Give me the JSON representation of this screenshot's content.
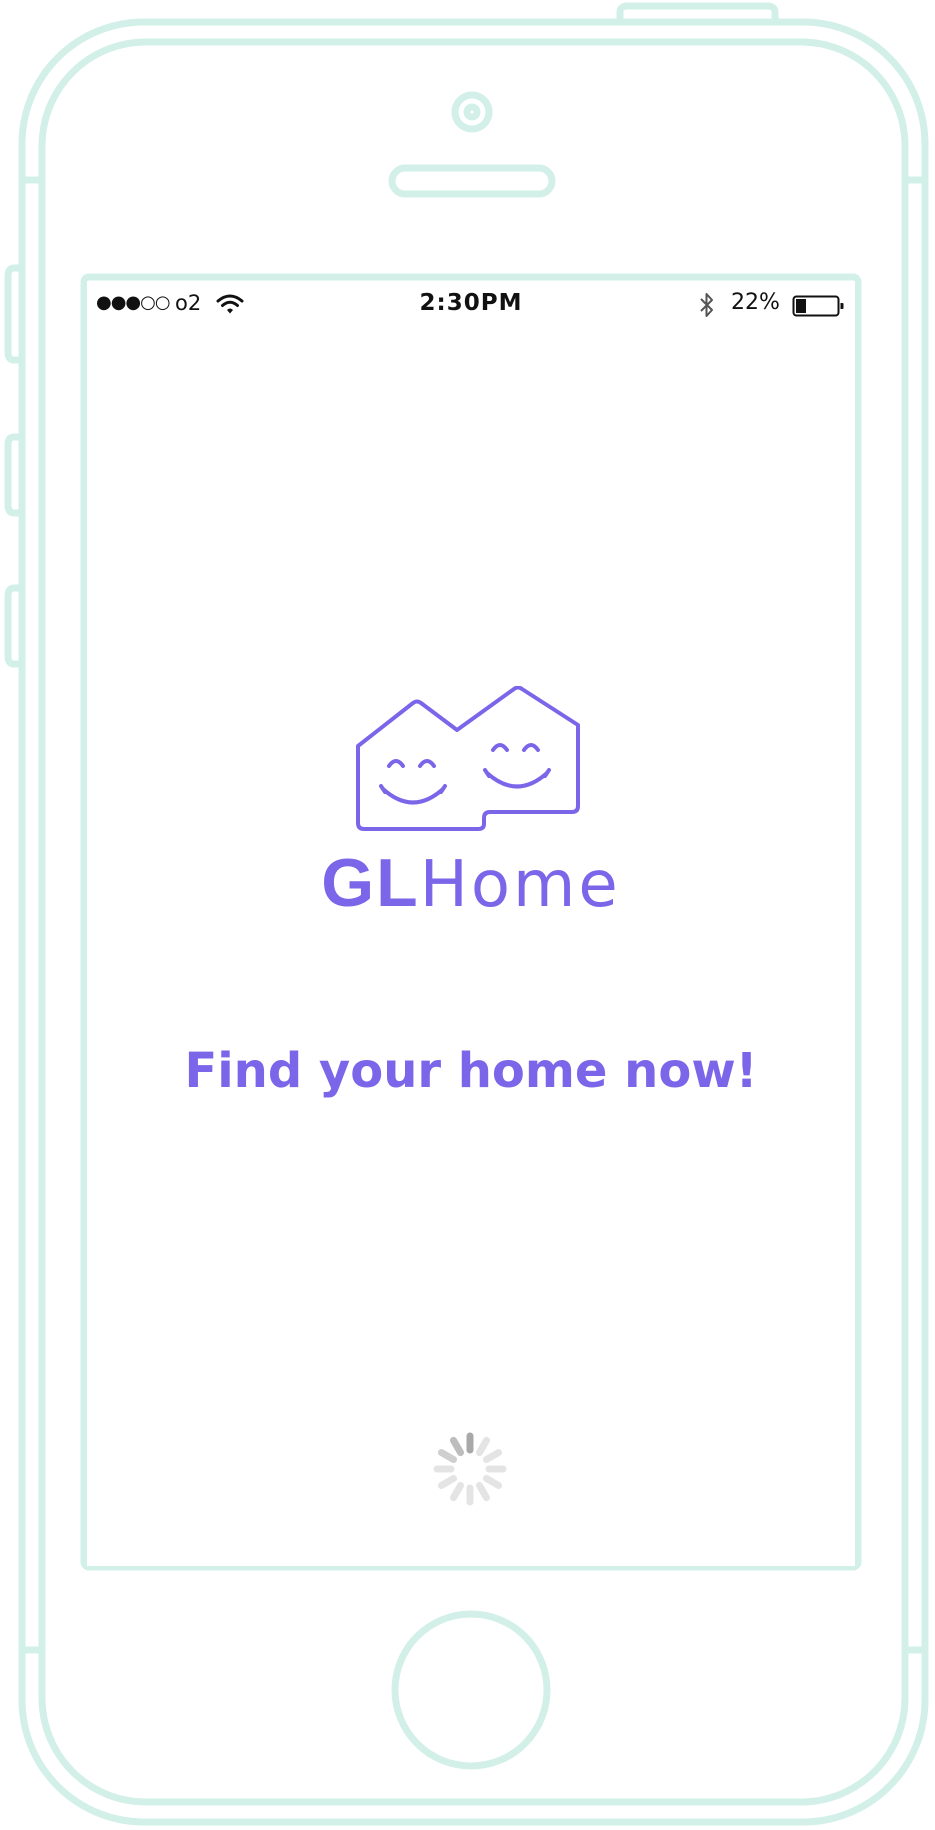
{
  "status_bar": {
    "signal": "●●●○○",
    "carrier": "o2",
    "time": "2:30PM",
    "battery_percent": "22%",
    "battery_level": 0.22,
    "icons": [
      "wifi-icon",
      "bluetooth-icon",
      "battery-icon"
    ]
  },
  "brand": {
    "name_bold": "GL",
    "name_light": "Home",
    "logo_icon": "smiling-houses-logo-icon"
  },
  "tagline": "Find your home now!",
  "loading": {
    "icon": "loading-spinner-icon"
  },
  "colors": {
    "accent": "#7b65e9",
    "frame": "#d2f0e8",
    "text": "#111111",
    "spinner": "#c8c8c8"
  }
}
